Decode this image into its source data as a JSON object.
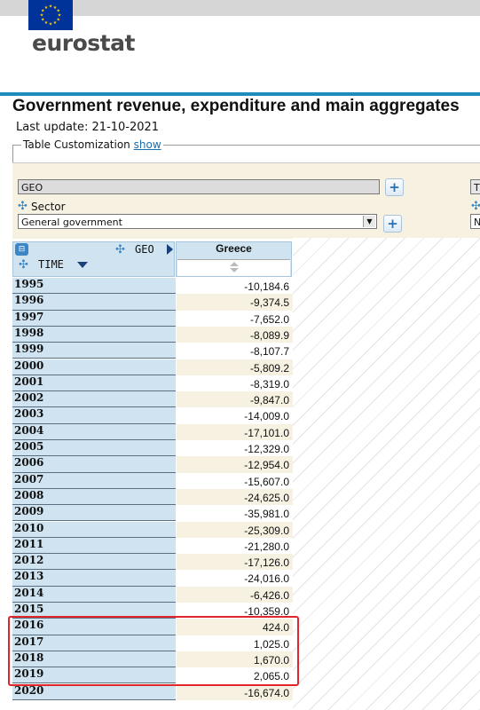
{
  "brand": {
    "name": "eurostat",
    "flag_color": "#003399",
    "star_color": "#ffcc00",
    "accent_color": "#1e8dbd"
  },
  "page": {
    "title": "Government revenue, expenditure and main aggregates",
    "last_update": "Last update: 21-10-2021"
  },
  "customization": {
    "legend": "Table Customization",
    "show_link": "show",
    "geo_field": "GEO",
    "geo_field_right": "T",
    "sector_label": "Sector",
    "sector_value": "General government",
    "sector_value_right": "N"
  },
  "table": {
    "geo_header": "GEO",
    "time_header": "TIME",
    "column": "Greece",
    "rows": [
      {
        "year": "1995",
        "value": "-10,184.6"
      },
      {
        "year": "1996",
        "value": "-9,374.5"
      },
      {
        "year": "1997",
        "value": "-7,652.0"
      },
      {
        "year": "1998",
        "value": "-8,089.9"
      },
      {
        "year": "1999",
        "value": "-8,107.7"
      },
      {
        "year": "2000",
        "value": "-5,809.2"
      },
      {
        "year": "2001",
        "value": "-8,319.0"
      },
      {
        "year": "2002",
        "value": "-9,847.0"
      },
      {
        "year": "2003",
        "value": "-14,009.0"
      },
      {
        "year": "2004",
        "value": "-17,101.0"
      },
      {
        "year": "2005",
        "value": "-12,329.0"
      },
      {
        "year": "2006",
        "value": "-12,954.0"
      },
      {
        "year": "2007",
        "value": "-15,607.0"
      },
      {
        "year": "2008",
        "value": "-24,625.0"
      },
      {
        "year": "2009",
        "value": "-35,981.0"
      },
      {
        "year": "2010",
        "value": "-25,309.0"
      },
      {
        "year": "2011",
        "value": "-21,280.0"
      },
      {
        "year": "2012",
        "value": "-17,126.0"
      },
      {
        "year": "2013",
        "value": "-24,016.0"
      },
      {
        "year": "2014",
        "value": "-6,426.0"
      },
      {
        "year": "2015",
        "value": "-10,359.0"
      },
      {
        "year": "2016",
        "value": "424.0"
      },
      {
        "year": "2017",
        "value": "1,025.0"
      },
      {
        "year": "2018",
        "value": "1,670.0"
      },
      {
        "year": "2019",
        "value": "2,065.0"
      },
      {
        "year": "2020",
        "value": "-16,674.0"
      }
    ],
    "highlight_color": "#e0262b"
  }
}
